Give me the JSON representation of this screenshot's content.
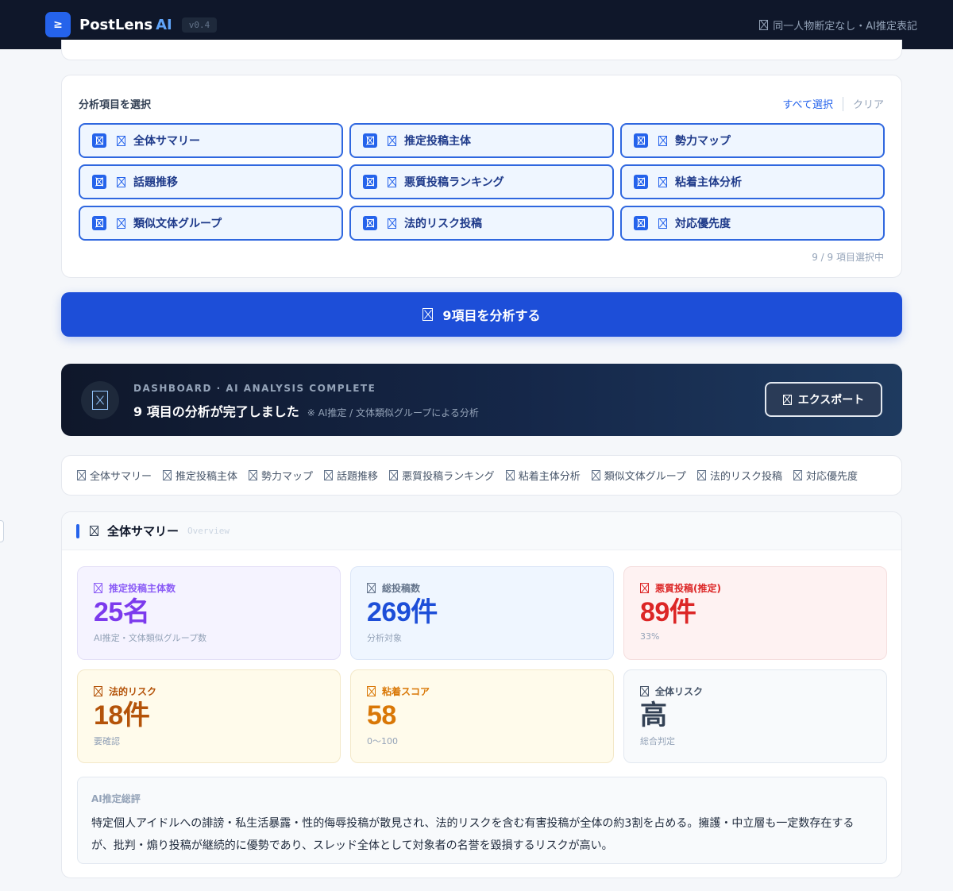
{
  "header": {
    "logo_glyph": "≥",
    "brand": "PostLens",
    "brand_ai": "AI",
    "version": "v0.4",
    "note": "同一人物断定なし・AI推定表記",
    "note_icon": "placeholder-icon"
  },
  "selection": {
    "title": "分析項目を選択",
    "select_all": "すべて選択",
    "clear": "クリア",
    "items": [
      {
        "label": "全体サマリー",
        "checked": true
      },
      {
        "label": "推定投稿主体",
        "checked": true
      },
      {
        "label": "勢力マップ",
        "checked": true
      },
      {
        "label": "話題推移",
        "checked": true
      },
      {
        "label": "悪質投稿ランキング",
        "checked": true
      },
      {
        "label": "粘着主体分析",
        "checked": true
      },
      {
        "label": "類似文体グループ",
        "checked": true
      },
      {
        "label": "法的リスク投稿",
        "checked": true
      },
      {
        "label": "対応優先度",
        "checked": true
      }
    ],
    "count_text": "9 / 9 項目選択中"
  },
  "analyze_button": "9項目を分析する",
  "dashboard": {
    "kicker": "DASHBOARD · AI ANALYSIS COMPLETE",
    "title": "9 項目の分析が完了しました",
    "note": "※ AI推定 / 文体類似グループによる分析",
    "export": "エクスポート"
  },
  "tabs": [
    "全体サマリー",
    "推定投稿主体",
    "勢力マップ",
    "話題推移",
    "悪質投稿ランキング",
    "粘着主体分析",
    "類似文体グループ",
    "法的リスク投稿",
    "対応優先度"
  ],
  "summary": {
    "title": "全体サマリー",
    "subtitle": "Overview",
    "stats": [
      {
        "label": "推定投稿主体数",
        "value": "25名",
        "sub": "AI推定・文体類似グループ数",
        "color": "#7c3aed"
      },
      {
        "label": "総投稿数",
        "value": "269件",
        "sub": "分析対象",
        "color": "#1d4ed8"
      },
      {
        "label": "悪質投稿(推定)",
        "value": "89件",
        "sub": "33%",
        "color": "#dc2626"
      },
      {
        "label": "法的リスク",
        "value": "18件",
        "sub": "要確認",
        "color": "#b45309"
      },
      {
        "label": "粘着スコア",
        "value": "58",
        "sub": "0〜100",
        "color": "#d97706"
      },
      {
        "label": "全体リスク",
        "value": "高",
        "sub": "総合判定",
        "color": "#334155"
      }
    ],
    "review": {
      "label": "AI推定総評",
      "text": "特定個人アイドルへの誹謗・私生活暴露・性的侮辱投稿が散見され、法的リスクを含む有害投稿が全体の約3割を占める。擁護・中立層も一定数存在するが、批判・煽り投稿が継続的に優勢であり、スレッド全体として対象者の名誉を毀損するリスクが高い。"
    }
  }
}
